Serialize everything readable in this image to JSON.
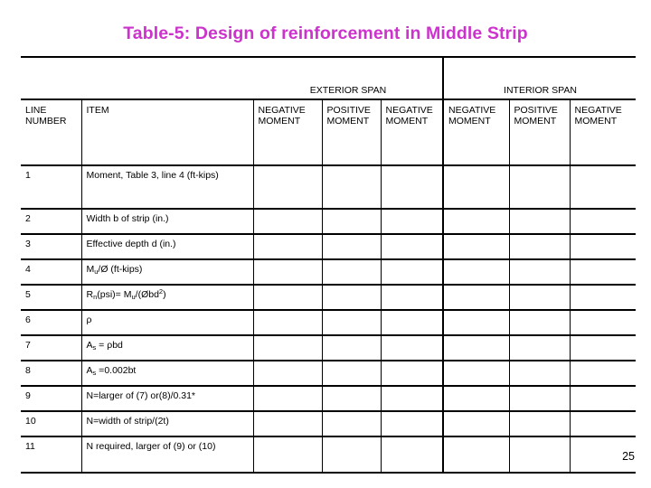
{
  "slide": {
    "title": "Table-5: Design of reinforcement in Middle Strip",
    "title_color": "#cc33cc",
    "page_number": "25"
  },
  "table": {
    "span_headers": {
      "exterior": "EXTERIOR SPAN",
      "interior": "INTERIOR SPAN"
    },
    "column_headers": {
      "line_number": "LINE NUMBER",
      "item": "ITEM",
      "moments": [
        "NEGATIVE MOMENT",
        "POSITIVE MOMENT",
        "NEGATIVE MOMENT",
        "NEGATIVE MOMENT",
        "POSITIVE MOMENT",
        "NEGATIVE MOMENT"
      ]
    },
    "rows": [
      {
        "line": "1",
        "item_html": "Moment, Table 3, line 4 (ft-kips)"
      },
      {
        "line": "2",
        "item_html": "Width b of strip (in.)"
      },
      {
        "line": "3",
        "item_html": "Effective depth d (in.)"
      },
      {
        "line": "4",
        "item_html": "M<sub>u</sub>/Ø (ft-kips)"
      },
      {
        "line": "5",
        "item_html": "R<sub>n</sub>(psi)= M<sub>u</sub>/(Øbd<sup>2</sup>)"
      },
      {
        "line": "6",
        "item_html": "ρ"
      },
      {
        "line": "7",
        "item_html": "A<sub>s</sub> = ρbd"
      },
      {
        "line": "8",
        "item_html": "A<sub>s</sub> =0.002bt"
      },
      {
        "line": "9",
        "item_html": "N=larger of (7) or(8)/0.31*"
      },
      {
        "line": "10",
        "item_html": "N=width of strip/(2t)"
      },
      {
        "line": "11",
        "item_html": "N required, larger of (9) or (10)"
      }
    ]
  }
}
